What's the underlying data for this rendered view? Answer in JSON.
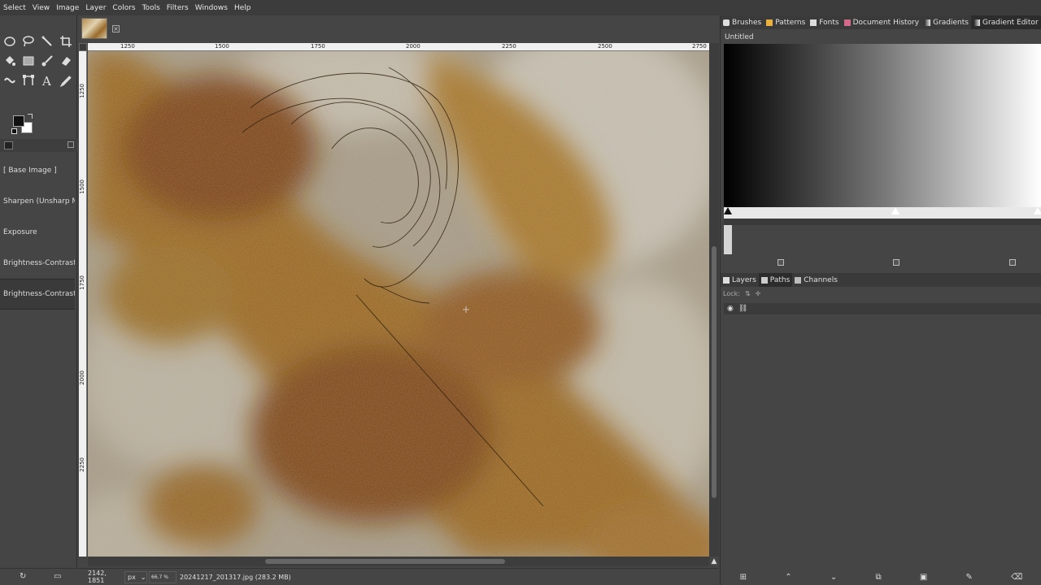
{
  "menu": [
    "Select",
    "View",
    "Image",
    "Layer",
    "Colors",
    "Tools",
    "Filters",
    "Windows",
    "Help"
  ],
  "tools": [
    "ellipse-select",
    "free-select",
    "fuzzy-select",
    "crop",
    "fill",
    "gradient",
    "paintbrush",
    "eraser",
    "warp",
    "path",
    "text",
    "color-picker"
  ],
  "colors": {
    "foreground": "#111111",
    "background": "#ffffff"
  },
  "image_tab": {
    "close": "×"
  },
  "ruler": {
    "top": [
      "1250",
      "1500",
      "1750",
      "2000",
      "2250",
      "2500",
      "2750"
    ],
    "left": [
      "1250",
      "1500",
      "1750",
      "2000",
      "2250"
    ]
  },
  "history": [
    "[ Base Image ]",
    "Sharpen (Unsharp Ma",
    "Exposure",
    "Brightness-Contrast",
    "Brightness-Contrast"
  ],
  "status": {
    "coords": "2142, 1851",
    "unit": "px",
    "zoom": "66.7 %",
    "file": "20241217_201317.jpg (283.2 MB)"
  },
  "dock_top_tabs": [
    "Brushes",
    "Patterns",
    "Fonts",
    "Document History",
    "Gradients",
    "Gradient Editor"
  ],
  "gradient": {
    "name": "Untitled"
  },
  "dock_bottom_tabs": [
    "Layers",
    "Paths",
    "Channels"
  ],
  "lock_label": "Lock:"
}
